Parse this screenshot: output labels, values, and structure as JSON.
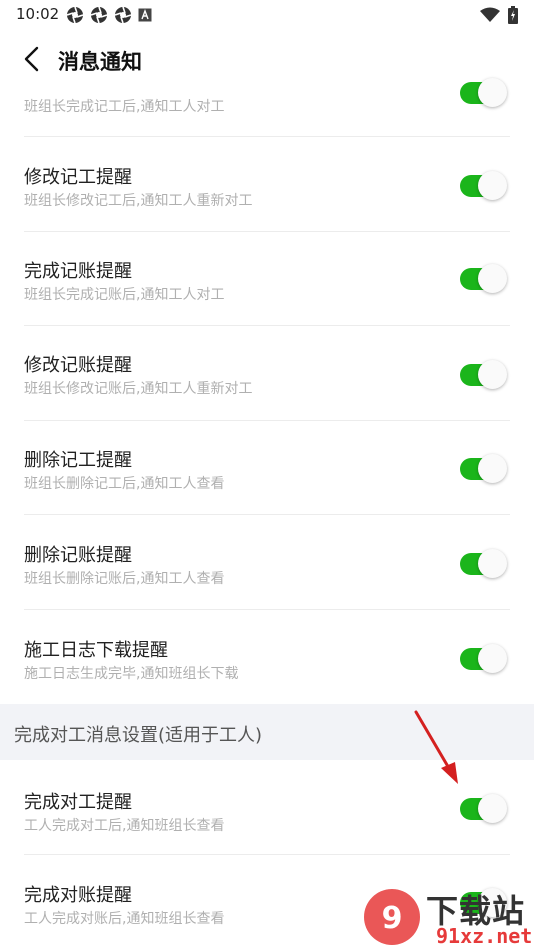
{
  "status_bar": {
    "time": "10:02",
    "left_icons": [
      "aperture-icon",
      "aperture-icon",
      "aperture-icon",
      "a-box-icon"
    ],
    "right_icons": [
      "wifi-icon",
      "battery-icon"
    ]
  },
  "header": {
    "title": "消息通知"
  },
  "settings": [
    {
      "title": "",
      "subtitle": "班组长完成记工后,通知工人对工",
      "enabled": true
    },
    {
      "title": "修改记工提醒",
      "subtitle": "班组长修改记工后,通知工人重新对工",
      "enabled": true
    },
    {
      "title": "完成记账提醒",
      "subtitle": "班组长完成记账后,通知工人对工",
      "enabled": true
    },
    {
      "title": "修改记账提醒",
      "subtitle": "班组长修改记账后,通知工人重新对工",
      "enabled": true
    },
    {
      "title": "删除记工提醒",
      "subtitle": "班组长删除记工后,通知工人查看",
      "enabled": true
    },
    {
      "title": "删除记账提醒",
      "subtitle": "班组长删除记账后,通知工人查看",
      "enabled": true
    },
    {
      "title": "施工日志下载提醒",
      "subtitle": "施工日志生成完毕,通知班组长下载",
      "enabled": true
    }
  ],
  "section": {
    "label": "完成对工消息设置(适用于工人)"
  },
  "worker_settings": [
    {
      "title": "完成对工提醒",
      "subtitle": "工人完成对工后,通知班组长查看",
      "enabled": true
    },
    {
      "title": "完成对账提醒",
      "subtitle": "工人完成对账后,通知班组长查看",
      "enabled": true
    }
  ],
  "watermark": {
    "text": "下载站",
    "url": "91xz.net"
  },
  "colors": {
    "toggle_on": "#1bb51b",
    "divider": "#ececec",
    "section_bg": "#f2f3f7",
    "annotation_arrow": "#d42020"
  }
}
